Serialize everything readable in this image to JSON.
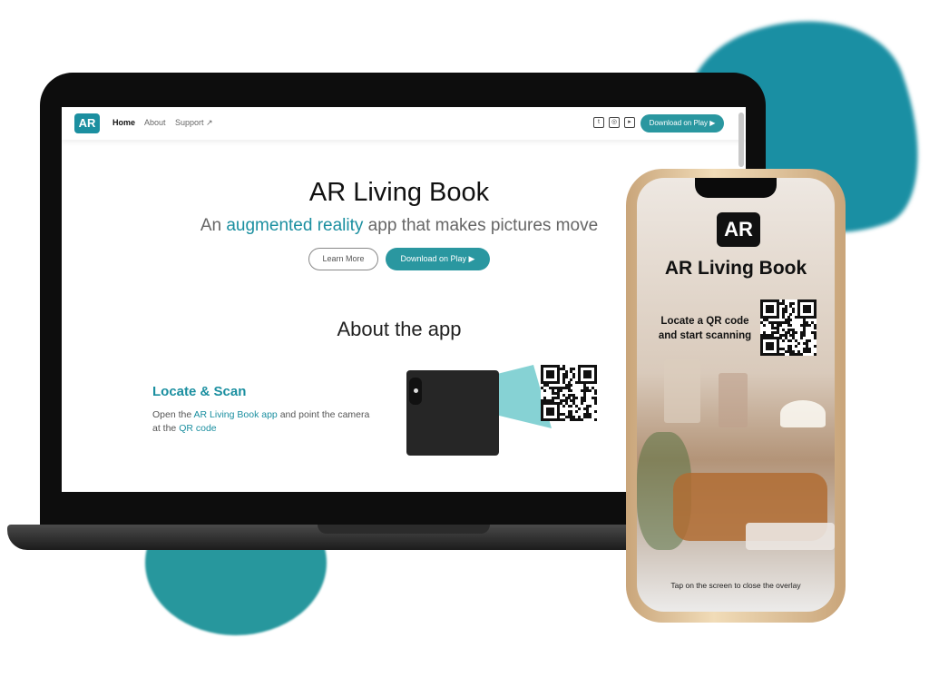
{
  "laptop_site": {
    "nav": {
      "logo": "AR",
      "links": [
        "Home",
        "About",
        "Support"
      ],
      "social": [
        "twitter-icon",
        "instagram-icon",
        "youtube-icon"
      ],
      "download_label": "Download on Play ▶"
    },
    "hero": {
      "title": "AR Living Book",
      "subtitle_prefix": "An ",
      "subtitle_highlight": "augmented reality",
      "subtitle_suffix": " app that makes pictures move",
      "learn_more": "Learn More",
      "download": "Download on Play ▶"
    },
    "about": {
      "title": "About the app",
      "feature_title": "Locate & Scan",
      "desc_1": "Open the ",
      "desc_link1": "AR Living Book app",
      "desc_2": " and point the camera at the ",
      "desc_link2": "QR code"
    }
  },
  "phone": {
    "logo": "AR",
    "title": "AR Living Book",
    "instruction": "Locate a QR code and start scanning",
    "hint": "Tap on the screen to close the overlay"
  },
  "colors": {
    "accent": "#1b8fa0",
    "button": "#2a97a0",
    "blob_blue": "#1a8fa3",
    "blob_teal": "#27979d"
  }
}
